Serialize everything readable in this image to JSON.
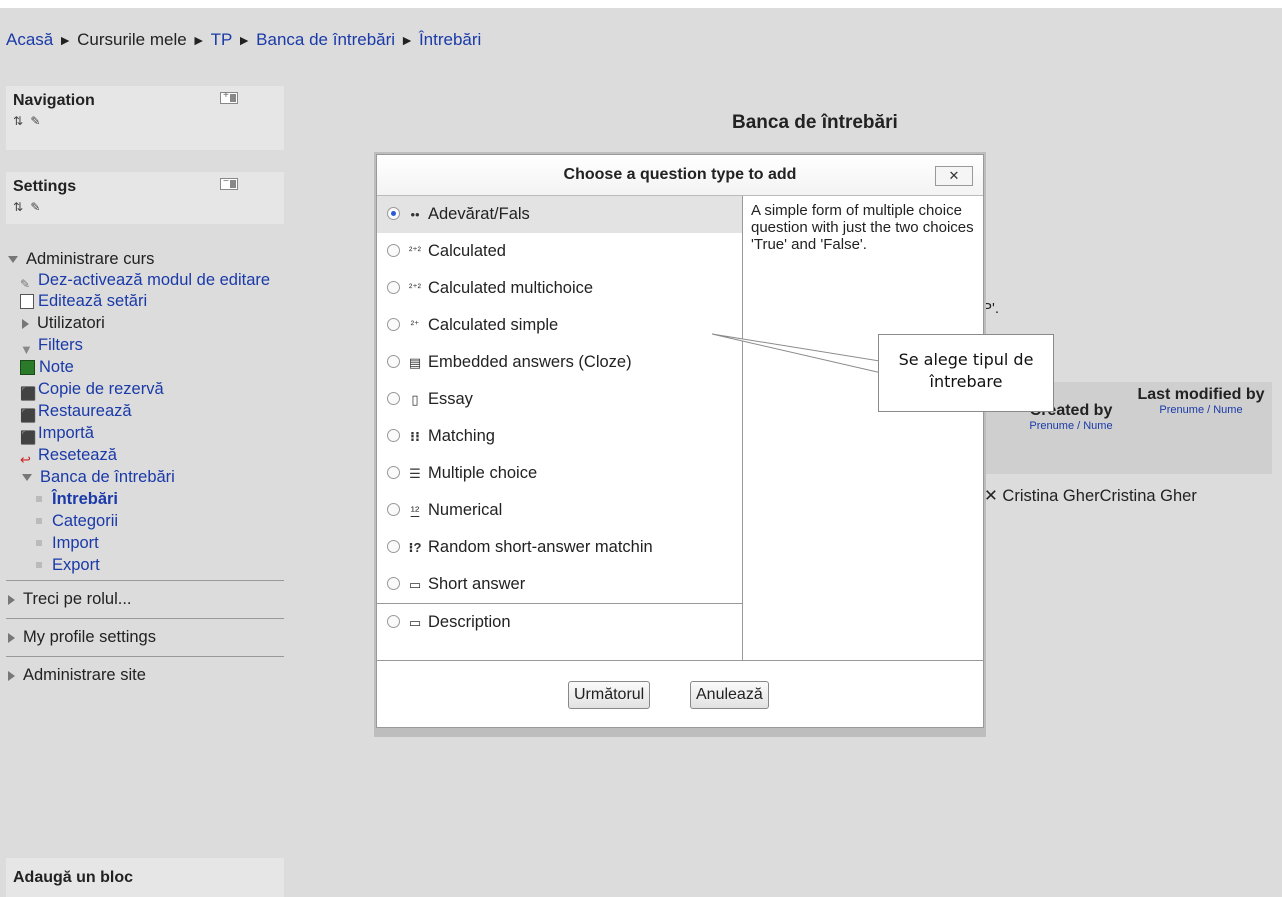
{
  "breadcrumb": {
    "items": [
      "Acasă",
      "Cursurile mele",
      "TP",
      "Banca de întrebări",
      "Întrebări"
    ],
    "separator": "►"
  },
  "navigation_block": {
    "title": "Navigation",
    "ctrl": "+"
  },
  "settings_block": {
    "title": "Settings",
    "ctrl": "−",
    "admin_label": "Administrare curs",
    "items": [
      "Dez-activează modul de editare",
      "Editează setări",
      "Utilizatori",
      "Filters",
      "Note",
      "Copie de rezervă",
      "Restaurează",
      "Importă",
      "Resetează",
      "Banca de întrebări"
    ],
    "bank_items": [
      "Întrebări",
      "Categorii",
      "Import",
      "Export"
    ],
    "collapsed": [
      "Treci pe rolul...",
      "My profile settings",
      "Administrare site"
    ]
  },
  "add_block": {
    "title": "Adaugă un bloc"
  },
  "main": {
    "heading": "Banca de întrebări",
    "fragment_p": "P'.",
    "columns": [
      {
        "label": "Created by",
        "sub": "Prenume / Nume"
      },
      {
        "label": "Last modified by",
        "sub": "Prenume / Nume"
      }
    ],
    "row": {
      "delete_icon": "✕",
      "created": "Cristina Gher",
      "modified": "Cristina Gher"
    }
  },
  "dialog": {
    "title": "Choose a question type to add",
    "close": "✕",
    "options": [
      {
        "icon": "••",
        "label": "Adevărat/Fals",
        "selected": true
      },
      {
        "icon": "²⁺²",
        "label": "Calculated"
      },
      {
        "icon": "²⁺²",
        "label": "Calculated multichoice"
      },
      {
        "icon": "²⁺",
        "label": "Calculated simple"
      },
      {
        "icon": "▤",
        "label": "Embedded answers (Cloze)"
      },
      {
        "icon": "▯",
        "label": "Essay"
      },
      {
        "icon": "⁝⁝",
        "label": "Matching"
      },
      {
        "icon": "☰",
        "label": "Multiple choice"
      },
      {
        "icon": "¹²",
        "label": "Numerical"
      },
      {
        "icon": "⁝?",
        "label": "Random short-answer matchin"
      },
      {
        "icon": "▭",
        "label": "Short answer"
      },
      {
        "icon": "▭",
        "label": "Description"
      }
    ],
    "description": "A simple form of multiple choice question with just the two choices 'True' and 'False'.",
    "buttons": {
      "next": "Următorul",
      "cancel": "Anulează"
    }
  },
  "callout": {
    "text_line1": "Se alege tipul de",
    "text_line2": "întrebare"
  }
}
